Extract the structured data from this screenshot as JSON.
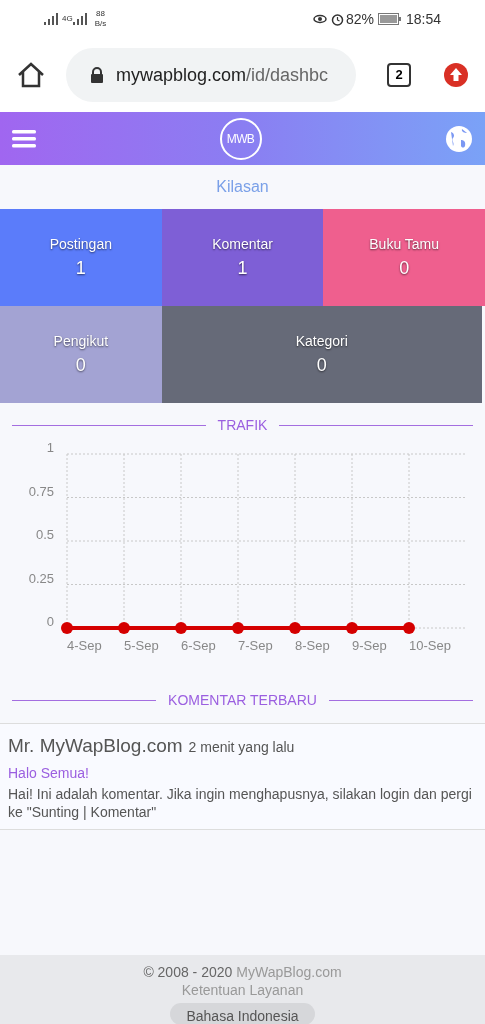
{
  "status_bar": {
    "network": "4G",
    "speed_value": "88",
    "speed_unit": "B/s",
    "battery": "82%",
    "time": "18:54"
  },
  "browser": {
    "url_host": "mywapblog.com",
    "url_path": "/id/dashbc",
    "tab_count": "2"
  },
  "header": {
    "logo": "MWB"
  },
  "section_title": "Kilasan",
  "tiles": [
    {
      "label": "Postingan",
      "value": "1",
      "color": "#5b7cfa"
    },
    {
      "label": "Komentar",
      "value": "1",
      "color": "#7e5fd6"
    },
    {
      "label": "Buku Tamu",
      "value": "0",
      "color": "#ef5f8e"
    },
    {
      "label": "Pengikut",
      "value": "0",
      "color": "#a3a3d3"
    },
    {
      "label": "Kategori",
      "value": "0",
      "color": "#666a78"
    }
  ],
  "traffic": {
    "heading": "TRAFIK",
    "chart_data": {
      "type": "line",
      "categories": [
        "4-Sep",
        "5-Sep",
        "6-Sep",
        "7-Sep",
        "8-Sep",
        "9-Sep",
        "10-Sep"
      ],
      "series": [
        {
          "color": "#d50000",
          "marker": true,
          "values": [
            0,
            0,
            0,
            0,
            0,
            0,
            0
          ]
        }
      ],
      "grid": true,
      "ylim": [
        0,
        1
      ],
      "yticks": [
        0,
        0.25,
        0.5,
        0.75,
        1
      ]
    }
  },
  "comments": {
    "heading": "KOMENTAR TERBARU",
    "items": [
      {
        "author": "Mr. MyWapBlog.com",
        "time": "2 menit yang lalu",
        "post": "Halo Semua!",
        "text": "Hai! Ini adalah komentar. Jika ingin menghapusnya, silakan login dan pergi ke \"Sunting | Komentar\""
      }
    ]
  },
  "footer": {
    "copyright": "© 2008 - 2020",
    "site_link": "MyWapBlog.com",
    "terms": "Ketentuan Layanan",
    "language": "Bahasa Indonesia"
  }
}
